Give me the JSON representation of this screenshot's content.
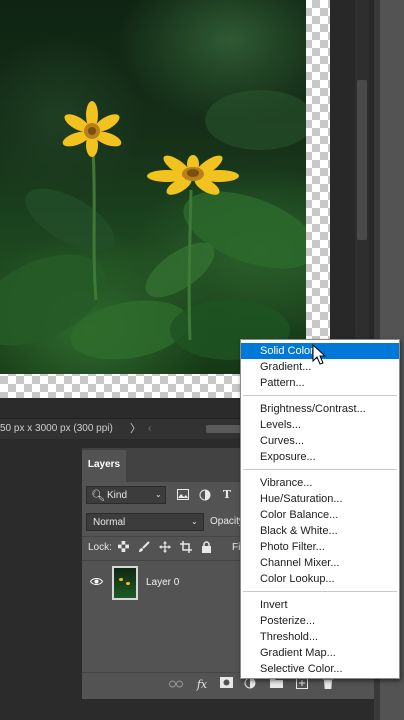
{
  "status_bar": {
    "dimensions": "50 px x 3000 px (300 ppi)",
    "arrow_right": "〉",
    "arrow_left": "‹"
  },
  "layers_panel": {
    "tab_label": "Layers",
    "kind_label": "Kind",
    "blend_mode": "Normal",
    "opacity_label": "Opacity",
    "lock_label": "Lock:",
    "fill_label": "Fi",
    "layer_name": "Layer 0",
    "icons": {
      "filter_search": "search-icon",
      "filter_image": "image-icon",
      "filter_adjustment": "adjustment-circle-icon",
      "filter_type": "type-icon",
      "lock_transparent": "checker-lock-icon",
      "lock_paint": "brush-icon",
      "lock_position": "move-icon",
      "lock_artboard": "crop-icon",
      "lock_all": "padlock-icon",
      "visibility": "eye-icon",
      "bottom": [
        "link-icon",
        "fx-icon",
        "mask-icon",
        "adjustment-layer-icon",
        "group-folder-icon",
        "new-layer-icon",
        "trash-icon"
      ]
    },
    "bottom_fx": "fx"
  },
  "adjustment_menu": {
    "groups": [
      [
        "Solid Color...",
        "Gradient...",
        "Pattern..."
      ],
      [
        "Brightness/Contrast...",
        "Levels...",
        "Curves...",
        "Exposure..."
      ],
      [
        "Vibrance...",
        "Hue/Saturation...",
        "Color Balance...",
        "Black & White...",
        "Photo Filter...",
        "Channel Mixer...",
        "Color Lookup..."
      ],
      [
        "Invert",
        "Posterize...",
        "Threshold...",
        "Gradient Map...",
        "Selective Color..."
      ]
    ],
    "selected": "Solid Color...",
    "items": {
      "solid_color": "Solid Color",
      "gradient": "Gradient...",
      "pattern": "Pattern...",
      "brightness_contrast": "Brightness/Contrast...",
      "levels": "Levels...",
      "curves": "Curves...",
      "exposure": "Exposure...",
      "vibrance": "Vibrance...",
      "hue_saturation": "Hue/Saturation...",
      "color_balance": "Color Balance...",
      "black_white": "Black & White...",
      "photo_filter": "Photo Filter...",
      "channel_mixer": "Channel Mixer...",
      "color_lookup": "Color Lookup...",
      "invert": "Invert",
      "posterize": "Posterize...",
      "threshold": "Threshold...",
      "gradient_map": "Gradient Map...",
      "selective_color": "Selective Color..."
    }
  },
  "colors": {
    "selection": "#0078d7",
    "panel": "#535353",
    "workspace": "#2b2b2b",
    "flower": "#f2c21e"
  }
}
